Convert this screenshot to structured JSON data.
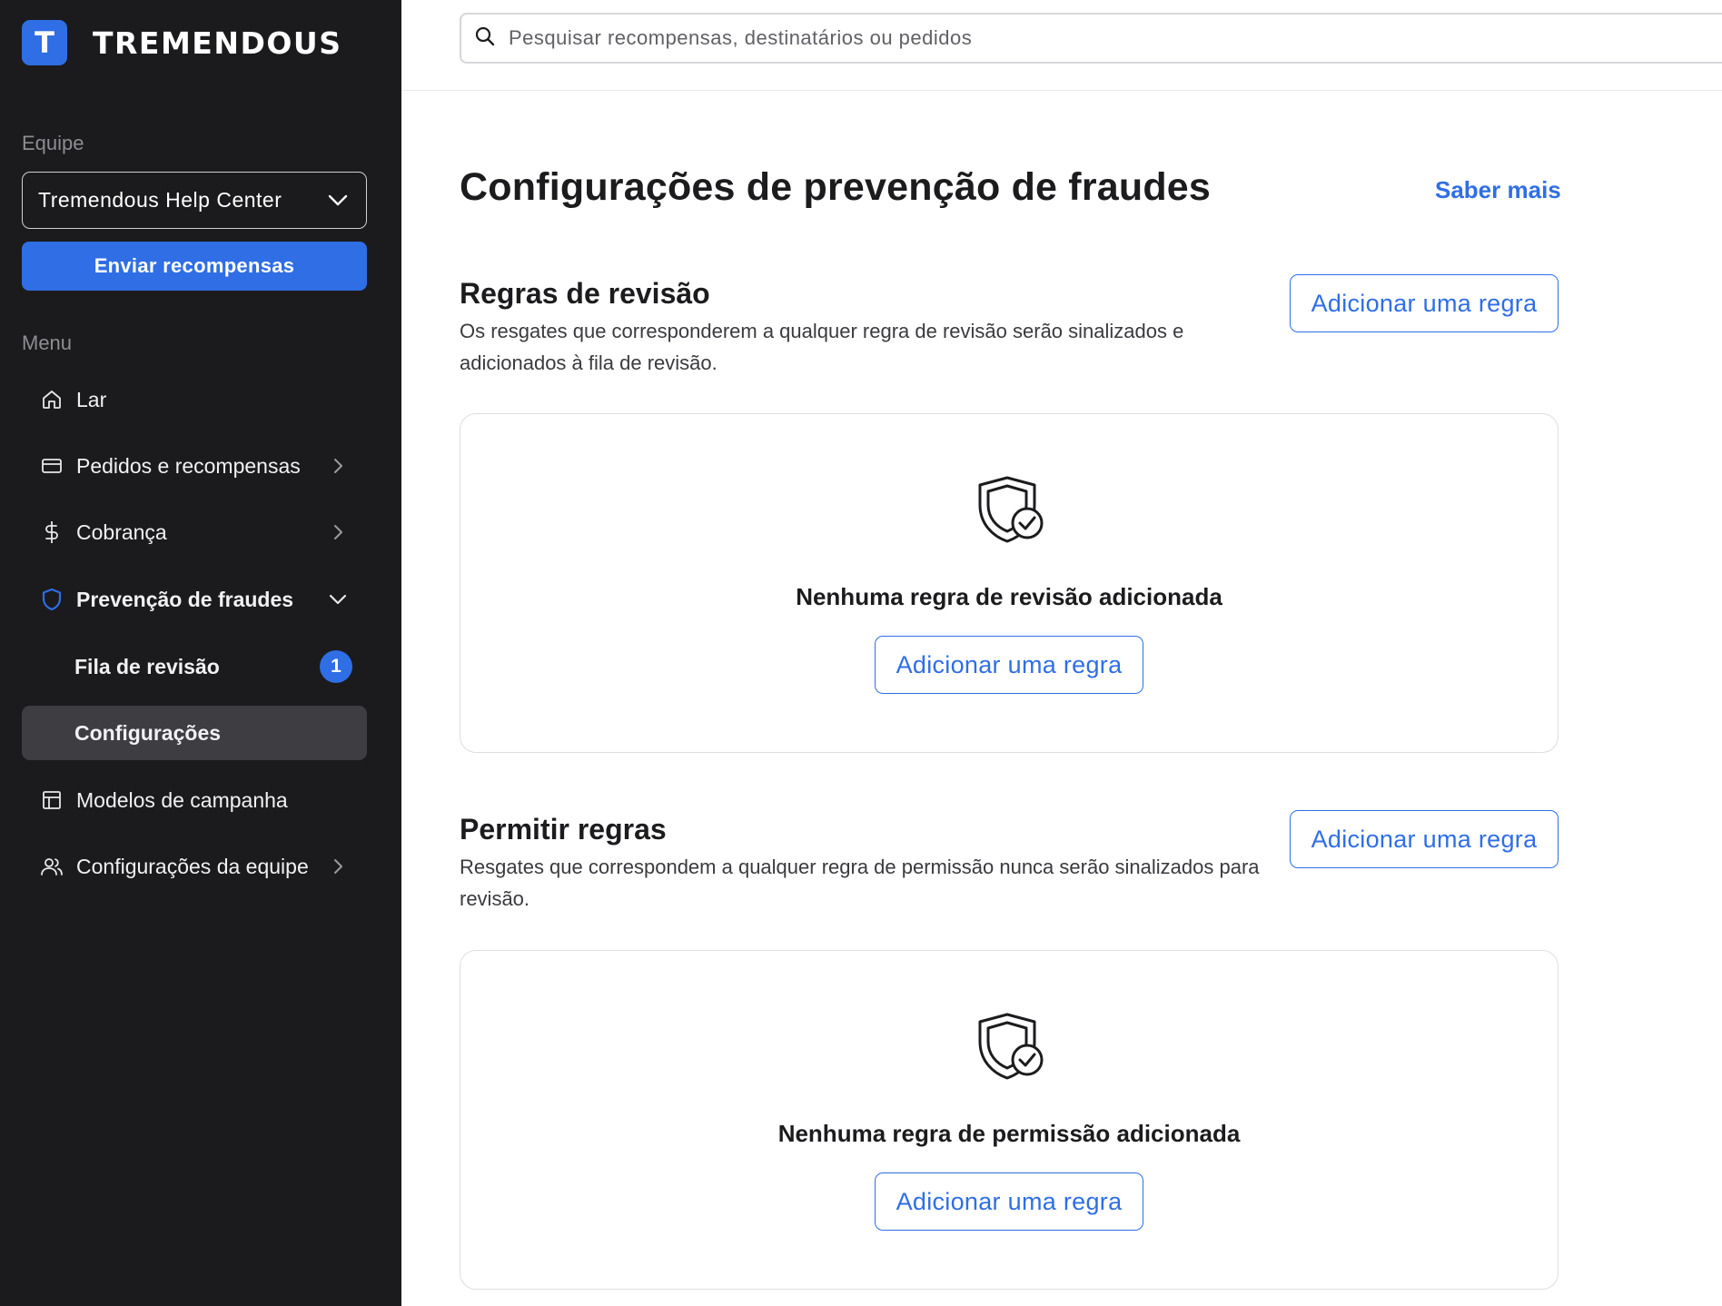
{
  "brand": {
    "logo_letter": "T",
    "name": "TREMENDOUS",
    "accent": "#2f6ee5"
  },
  "sidebar": {
    "team_label": "Equipe",
    "team_selected": "Tremendous Help Center",
    "send_button": "Enviar recompensas",
    "menu_label": "Menu",
    "items": [
      {
        "label": "Lar",
        "icon": "home-icon"
      },
      {
        "label": "Pedidos e recompensas",
        "icon": "card-icon",
        "expandable": true
      },
      {
        "label": "Cobrança",
        "icon": "dollar-icon",
        "expandable": true
      },
      {
        "label": "Prevenção de fraudes",
        "icon": "shield-icon",
        "expanded": true
      },
      {
        "label": "Fila de revisão",
        "badge": "1"
      },
      {
        "label": "Configurações",
        "active": true
      },
      {
        "label": "Modelos de campanha",
        "icon": "layout-icon"
      },
      {
        "label": "Configurações da equipe",
        "icon": "users-icon",
        "expandable": true
      }
    ]
  },
  "search": {
    "placeholder": "Pesquisar recompensas, destinatários ou pedidos"
  },
  "main": {
    "title": "Configurações de prevenção de fraudes",
    "learn_more": "Saber mais",
    "review_rules": {
      "title": "Regras de revisão",
      "description": "Os resgates que corresponderem a qualquer regra de revisão serão sinalizados e adicionados à fila de revisão.",
      "add_button": "Adicionar uma regra",
      "empty_text": "Nenhuma regra de revisão adicionada",
      "empty_button": "Adicionar uma regra"
    },
    "allow_rules": {
      "title": "Permitir regras",
      "description": "Resgates que correspondem a qualquer regra de permissão nunca serão sinalizados para revisão.",
      "add_button": "Adicionar uma regra",
      "empty_text": "Nenhuma regra de permissão adicionada",
      "empty_button": "Adicionar uma regra"
    }
  }
}
